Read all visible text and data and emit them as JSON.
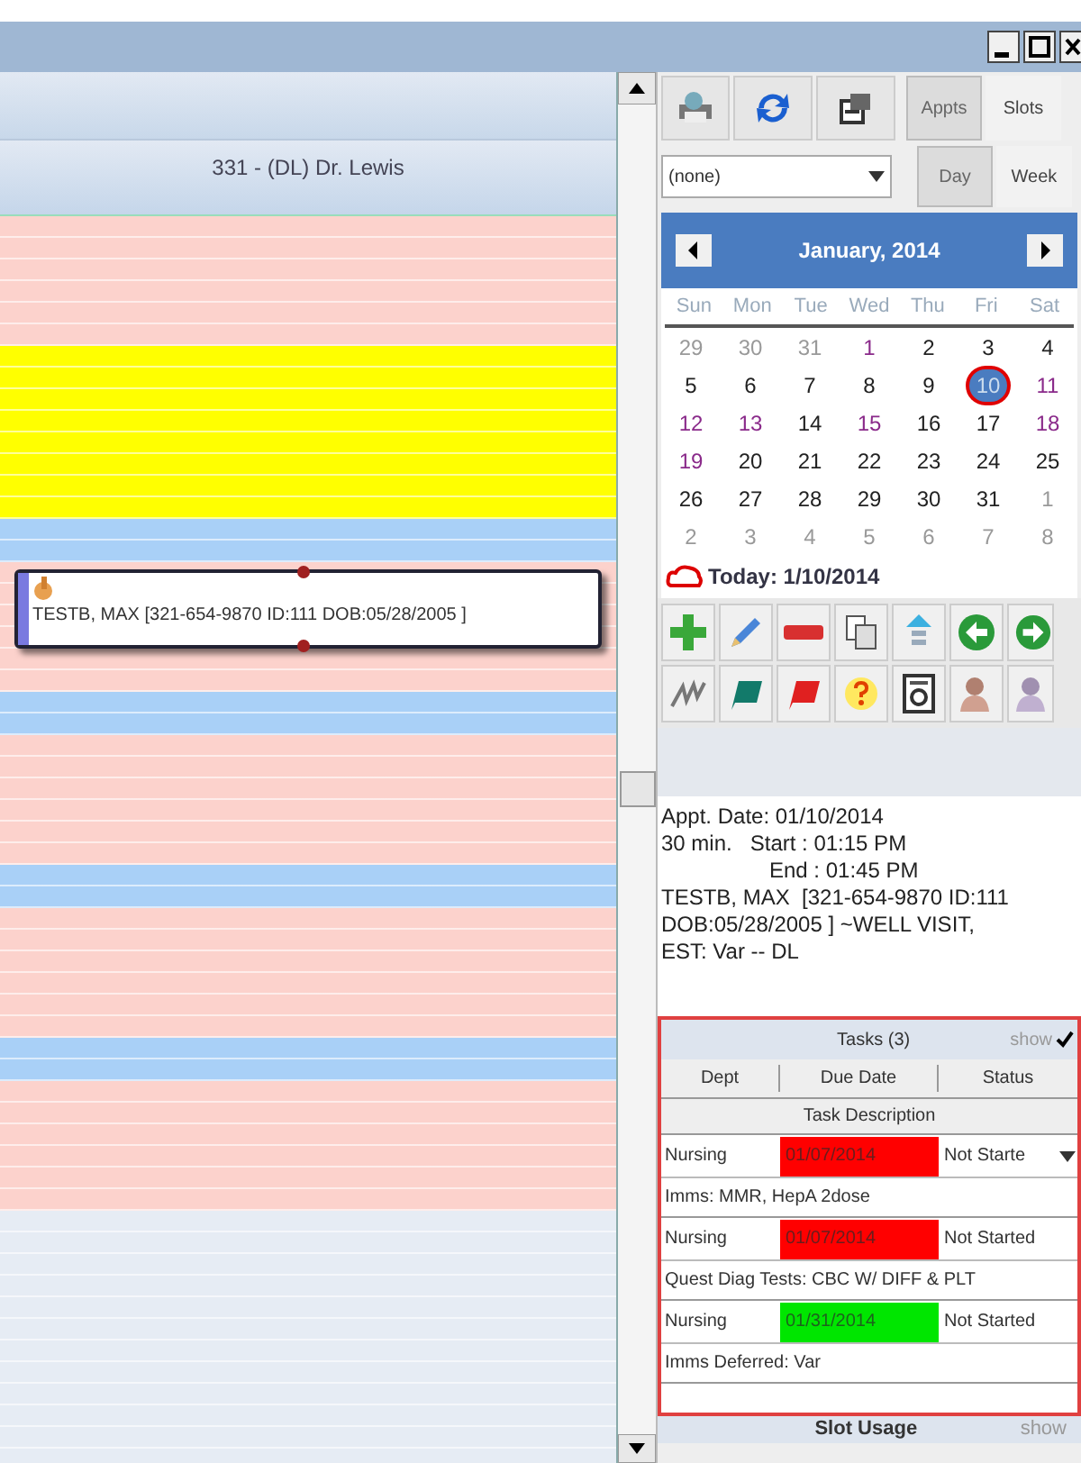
{
  "schedule": {
    "provider_header": "331  - (DL) Dr. Lewis",
    "slots": [
      {
        "kind": "open"
      },
      {
        "kind": "reserved"
      },
      {
        "kind": "break"
      },
      {
        "kind": "open",
        "appointment": {
          "text": "TESTB, MAX  [321-654-9870 ID:111 DOB:05/28/2005 ]"
        }
      },
      {
        "kind": "break"
      },
      {
        "kind": "open"
      },
      {
        "kind": "break"
      },
      {
        "kind": "open"
      },
      {
        "kind": "break"
      },
      {
        "kind": "open"
      },
      {
        "kind": "closed"
      }
    ]
  },
  "view_tabs": [
    {
      "label": "Appts",
      "selected": true
    },
    {
      "label": "Slots",
      "selected": false
    }
  ],
  "filter": {
    "value": "(none)"
  },
  "range_tabs": [
    {
      "label": "Day",
      "selected": true
    },
    {
      "label": "Week",
      "selected": false
    }
  ],
  "calendar": {
    "title": "January, 2014",
    "weekdays": [
      "Sun",
      "Mon",
      "Tue",
      "Wed",
      "Thu",
      "Fri",
      "Sat"
    ],
    "weeks": [
      [
        {
          "day": "29",
          "muted": true,
          "selected": false
        },
        {
          "day": "30",
          "muted": true,
          "selected": false
        },
        {
          "day": "31",
          "muted": true,
          "selected": false
        },
        {
          "day": "1",
          "muted": false,
          "marked": true,
          "selected": false
        },
        {
          "day": "2",
          "muted": false,
          "marked": false,
          "selected": false
        },
        {
          "day": "3",
          "muted": false,
          "marked": false,
          "selected": false
        },
        {
          "day": "4",
          "muted": false,
          "marked": false,
          "selected": false
        }
      ],
      [
        {
          "day": "5",
          "muted": false,
          "marked": false,
          "selected": false
        },
        {
          "day": "6",
          "muted": false,
          "marked": false,
          "selected": false
        },
        {
          "day": "7",
          "muted": false,
          "marked": false,
          "selected": false
        },
        {
          "day": "8",
          "muted": false,
          "marked": false,
          "selected": false
        },
        {
          "day": "9",
          "muted": false,
          "marked": false,
          "selected": false
        },
        {
          "day": "10",
          "muted": false,
          "marked": false,
          "selected": true
        },
        {
          "day": "11",
          "muted": false,
          "marked": true,
          "selected": false
        }
      ],
      [
        {
          "day": "12",
          "muted": false,
          "marked": true,
          "selected": false
        },
        {
          "day": "13",
          "muted": false,
          "marked": true,
          "selected": false
        },
        {
          "day": "14",
          "muted": false,
          "marked": false,
          "selected": false
        },
        {
          "day": "15",
          "muted": false,
          "marked": true,
          "selected": false
        },
        {
          "day": "16",
          "muted": false,
          "marked": false,
          "selected": false
        },
        {
          "day": "17",
          "muted": false,
          "marked": false,
          "selected": false
        },
        {
          "day": "18",
          "muted": false,
          "marked": true,
          "selected": false
        }
      ],
      [
        {
          "day": "19",
          "muted": false,
          "marked": true,
          "selected": false
        },
        {
          "day": "20",
          "muted": false,
          "marked": false,
          "selected": false
        },
        {
          "day": "21",
          "muted": false,
          "marked": false,
          "selected": false
        },
        {
          "day": "22",
          "muted": false,
          "marked": false,
          "selected": false
        },
        {
          "day": "23",
          "muted": false,
          "marked": false,
          "selected": false
        },
        {
          "day": "24",
          "muted": false,
          "marked": false,
          "selected": false
        },
        {
          "day": "25",
          "muted": false,
          "marked": false,
          "selected": false
        }
      ],
      [
        {
          "day": "26",
          "muted": false,
          "marked": false,
          "selected": false
        },
        {
          "day": "27",
          "muted": false,
          "marked": false,
          "selected": false
        },
        {
          "day": "28",
          "muted": false,
          "marked": false,
          "selected": false
        },
        {
          "day": "29",
          "muted": false,
          "marked": false,
          "selected": false
        },
        {
          "day": "30",
          "muted": false,
          "marked": false,
          "selected": false
        },
        {
          "day": "31",
          "muted": false,
          "marked": false,
          "selected": false
        },
        {
          "day": "1",
          "muted": true,
          "selected": false
        }
      ],
      [
        {
          "day": "2",
          "muted": true,
          "selected": false
        },
        {
          "day": "3",
          "muted": true,
          "selected": false
        },
        {
          "day": "4",
          "muted": true,
          "selected": false
        },
        {
          "day": "5",
          "muted": true,
          "selected": false
        },
        {
          "day": "6",
          "muted": true,
          "selected": false
        },
        {
          "day": "7",
          "muted": true,
          "selected": false
        },
        {
          "day": "8",
          "muted": true,
          "selected": false
        }
      ]
    ],
    "today": "Today: 1/10/2014"
  },
  "appointment_details": [
    "Appt. Date: 01/10/2014",
    "30 min.   Start : 01:15 PM",
    "End : 01:45 PM",
    "TESTB, MAX  [321-654-9870 ID:111",
    "DOB:05/28/2005 ] ~WELL VISIT,",
    "EST: Var -- DL"
  ],
  "tasks": {
    "title": "Tasks (3)",
    "show_label": "show",
    "show_checked": true,
    "columns": [
      "Dept",
      "Due Date",
      "Status"
    ],
    "description_header": "Task Description",
    "rows": [
      {
        "kind": "dropdown",
        "dept": "Nursing",
        "due": "01/07/2014",
        "color": "#ff0000",
        "status": "Not Starte",
        "description": "Imms: MMR, HepA 2dose"
      },
      {
        "kind": "text",
        "dept": "Nursing",
        "due": "01/07/2014",
        "color": "#ff0000",
        "status": "Not Started",
        "description": "Quest Diag Tests: CBC W/ DIFF  &  PLT"
      },
      {
        "kind": "text",
        "dept": "Nursing",
        "due": "01/31/2014",
        "color": "#00e600",
        "status": "Not Started",
        "description": "Imms Deferred: Var"
      }
    ]
  },
  "slot_usage": {
    "title": "Slot Usage",
    "show_label": "show"
  }
}
